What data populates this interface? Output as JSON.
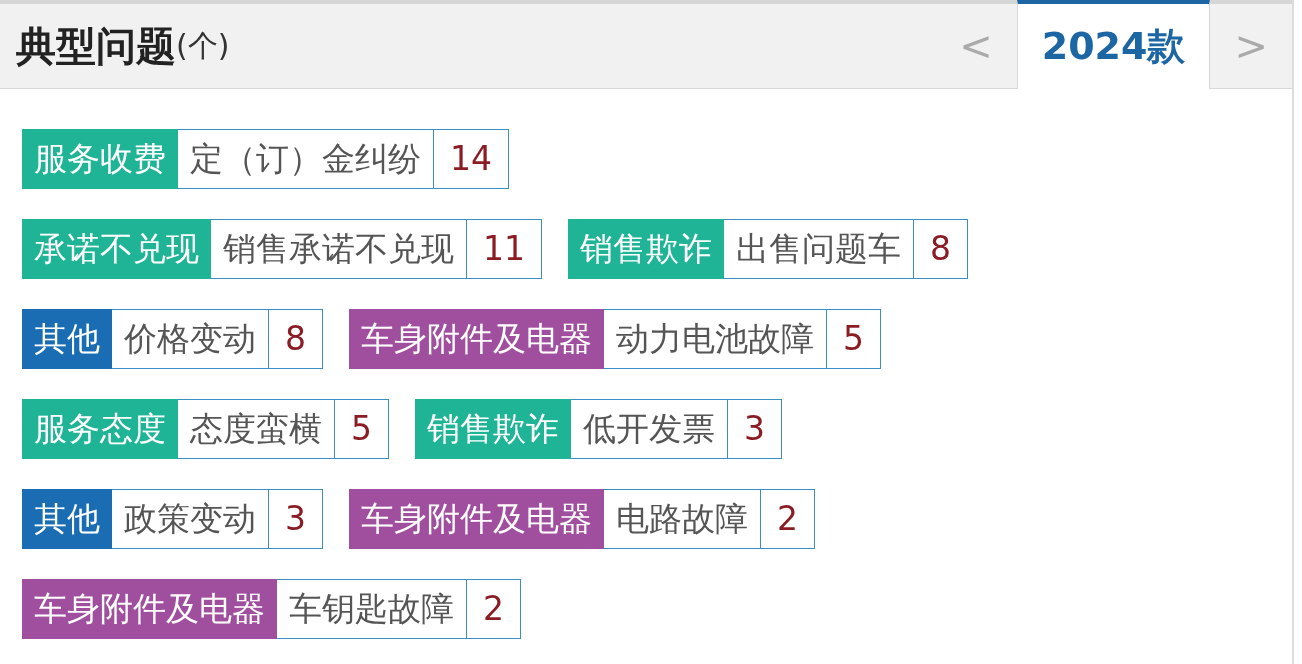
{
  "header": {
    "title": "典型问题",
    "unit": "(个)",
    "prev": "<",
    "year": {
      "label": "2024款",
      "selected": true
    },
    "next": ">"
  },
  "rows": [
    [
      {
        "category": "服务收费",
        "color": "#1fb496",
        "issue": "定（订）金纠纷",
        "count": "14"
      }
    ],
    [
      {
        "category": "承诺不兑现",
        "color": "#1fb496",
        "issue": "销售承诺不兑现",
        "count": "11"
      },
      {
        "category": "销售欺诈",
        "color": "#1fb496",
        "issue": "出售问题车",
        "count": "8"
      }
    ],
    [
      {
        "category": "其他",
        "color": "#1a6db3",
        "issue": "价格变动",
        "count": "8"
      },
      {
        "category": "车身附件及电器",
        "color": "#a04f9e",
        "issue": "动力电池故障",
        "count": "5"
      }
    ],
    [
      {
        "category": "服务态度",
        "color": "#1fb496",
        "issue": "态度蛮横",
        "count": "5"
      },
      {
        "category": "销售欺诈",
        "color": "#1fb496",
        "issue": "低开发票",
        "count": "3"
      }
    ],
    [
      {
        "category": "其他",
        "color": "#1a6db3",
        "issue": "政策变动",
        "count": "3"
      },
      {
        "category": "车身附件及电器",
        "color": "#a04f9e",
        "issue": "电路故障",
        "count": "2"
      }
    ],
    [
      {
        "category": "车身附件及电器",
        "color": "#a04f9e",
        "issue": "车钥匙故障",
        "count": "2"
      }
    ]
  ]
}
